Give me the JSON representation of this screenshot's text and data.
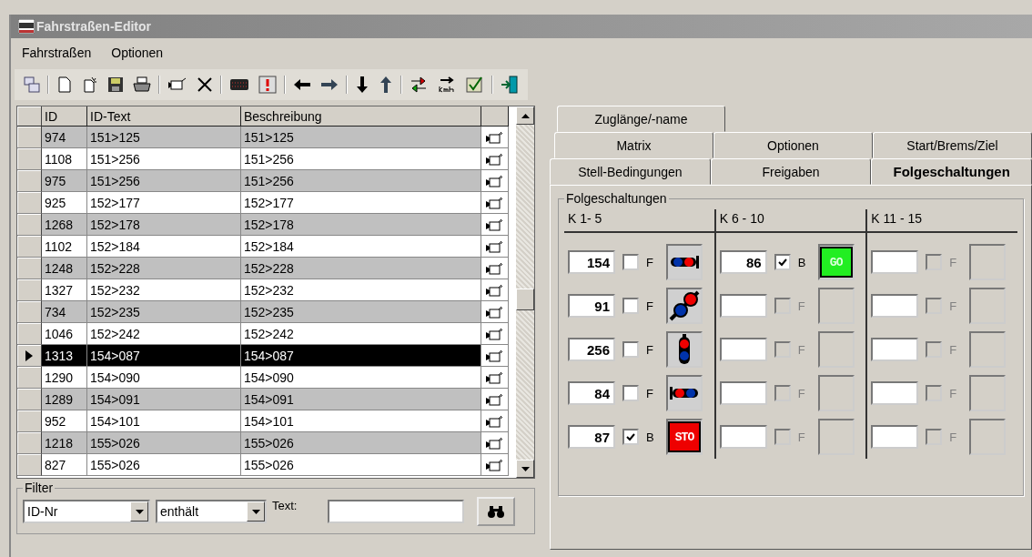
{
  "window": {
    "title": "Fahrstraßen-Editor"
  },
  "menu": [
    {
      "label": "Fahrstraßen"
    },
    {
      "label": "Optionen"
    }
  ],
  "table": {
    "columns": [
      "ID",
      "ID-Text",
      "Beschreibung"
    ],
    "rows": [
      {
        "id": "974",
        "text": "151>125",
        "desc": "151>125",
        "selected": false
      },
      {
        "id": "1108",
        "text": "151>256",
        "desc": "151>256",
        "selected": false
      },
      {
        "id": "975",
        "text": "151>256",
        "desc": "151>256",
        "selected": false
      },
      {
        "id": "925",
        "text": "152>177",
        "desc": "152>177",
        "selected": false
      },
      {
        "id": "1268",
        "text": "152>178",
        "desc": "152>178",
        "selected": false
      },
      {
        "id": "1102",
        "text": "152>184",
        "desc": "152>184",
        "selected": false
      },
      {
        "id": "1248",
        "text": "152>228",
        "desc": "152>228",
        "selected": false
      },
      {
        "id": "1327",
        "text": "152>232",
        "desc": "152>232",
        "selected": false
      },
      {
        "id": "734",
        "text": "152>235",
        "desc": "152>235",
        "selected": false
      },
      {
        "id": "1046",
        "text": "152>242",
        "desc": "152>242",
        "selected": false
      },
      {
        "id": "1313",
        "text": "154>087",
        "desc": "154>087",
        "selected": true
      },
      {
        "id": "1290",
        "text": "154>090",
        "desc": "154>090",
        "selected": false
      },
      {
        "id": "1289",
        "text": "154>091",
        "desc": "154>091",
        "selected": false
      },
      {
        "id": "952",
        "text": "154>101",
        "desc": "154>101",
        "selected": false
      },
      {
        "id": "1218",
        "text": "155>026",
        "desc": "155>026",
        "selected": false
      },
      {
        "id": "827",
        "text": "155>026",
        "desc": "155>026",
        "selected": false
      }
    ]
  },
  "filter": {
    "title": "Filter",
    "field": "ID-Nr",
    "operator": "enthält",
    "text_label": "Text:"
  },
  "tab_rows": [
    [
      {
        "label": "Zuglänge/-name",
        "selected": false
      }
    ],
    [
      {
        "label": "Matrix",
        "selected": false
      },
      {
        "label": "Optionen",
        "selected": false
      },
      {
        "label": "Start/Brems/Ziel",
        "selected": false
      }
    ],
    [
      {
        "label": "Stell-Bedingungen",
        "selected": false
      },
      {
        "label": "Freigaben",
        "selected": false
      },
      {
        "label": "Folgeschaltungen",
        "selected": true
      }
    ]
  ],
  "group": {
    "title": "Folgeschaltungen",
    "columns": [
      {
        "heading": "K 1- 5",
        "slots": [
          {
            "value": "154",
            "checked": false,
            "flag": "F",
            "disabled": false,
            "signal": {
              "kind": "horizontal-blue-red"
            }
          },
          {
            "value": "91",
            "checked": false,
            "flag": "F",
            "disabled": false,
            "signal": {
              "kind": "diagonal"
            }
          },
          {
            "value": "256",
            "checked": false,
            "flag": "F",
            "disabled": false,
            "signal": {
              "kind": "vertical"
            }
          },
          {
            "value": "84",
            "checked": false,
            "flag": "F",
            "disabled": false,
            "signal": {
              "kind": "horizontal-red-blue"
            }
          },
          {
            "value": "87",
            "checked": true,
            "flag": "B",
            "disabled": false,
            "signal": {
              "kind": "stop",
              "text": "STO"
            }
          }
        ]
      },
      {
        "heading": "K 6 - 10",
        "slots": [
          {
            "value": "86",
            "checked": true,
            "flag": "B",
            "disabled": false,
            "signal": {
              "kind": "go",
              "text": "GO"
            }
          },
          {
            "checked": false,
            "flag": "F",
            "disabled": true
          },
          {
            "checked": false,
            "flag": "F",
            "disabled": true
          },
          {
            "checked": false,
            "flag": "F",
            "disabled": true
          },
          {
            "checked": false,
            "flag": "F",
            "disabled": true
          }
        ]
      },
      {
        "heading": "K 11 - 15",
        "slots": [
          {
            "checked": false,
            "flag": "F",
            "disabled": true
          },
          {
            "checked": false,
            "flag": "F",
            "disabled": true
          },
          {
            "checked": false,
            "flag": "F",
            "disabled": true
          },
          {
            "checked": false,
            "flag": "F",
            "disabled": true
          },
          {
            "checked": false,
            "flag": "F",
            "disabled": true
          }
        ]
      }
    ]
  }
}
